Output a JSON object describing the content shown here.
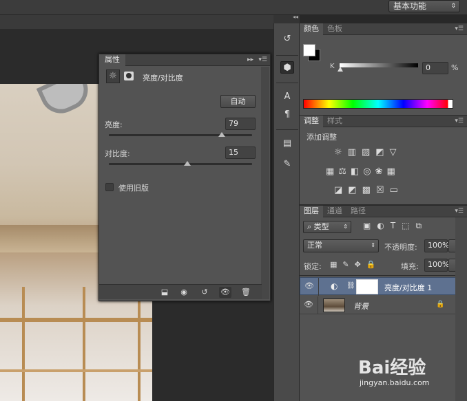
{
  "workspace": {
    "label": "基本功能"
  },
  "dock": {
    "icons": [
      "history-icon",
      "cube-3d-icon",
      "character-icon",
      "paragraph-icon",
      "notes-icon",
      "document-icon"
    ]
  },
  "color_panel": {
    "tabs": [
      "颜色",
      "色板"
    ],
    "channel_label": "K",
    "value": "0",
    "unit": "%"
  },
  "adjust_panel": {
    "tabs": [
      "调整",
      "样式"
    ],
    "heading": "添加调整"
  },
  "layers_panel": {
    "tabs": [
      "图层",
      "通道",
      "路径"
    ],
    "filter_label": "类型",
    "blend_mode": "正常",
    "opacity_label": "不透明度:",
    "opacity_value": "100%",
    "lock_label": "锁定:",
    "fill_label": "填充:",
    "fill_value": "100%",
    "layers": [
      {
        "name": "亮度/对比度 1",
        "type": "adjustment"
      },
      {
        "name": "背景",
        "type": "background"
      }
    ]
  },
  "properties": {
    "title": "属性",
    "panel_name": "亮度/对比度",
    "auto_label": "自动",
    "brightness_label": "亮度:",
    "brightness_value": "79",
    "brightness_level": 0.79,
    "contrast_label": "对比度:",
    "contrast_value": "15",
    "contrast_level": 0.55,
    "legacy_label": "使用旧版"
  },
  "watermark": {
    "brand": "Bai经验",
    "url": "jingyan.baidu.com"
  },
  "colors": {
    "ui_bg": "#535353",
    "dark": "#282828",
    "selected_layer": "#5e7190"
  }
}
